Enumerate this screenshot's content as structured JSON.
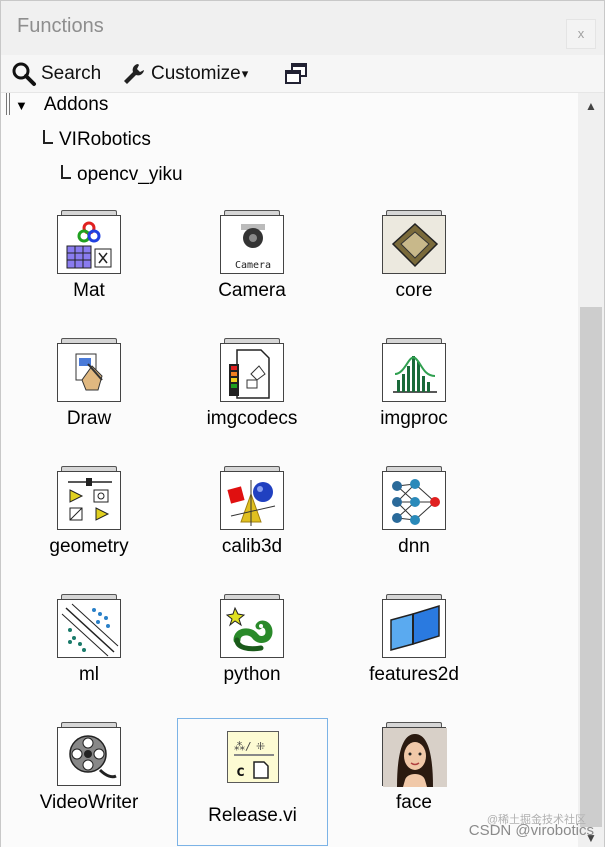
{
  "window": {
    "title": "Functions",
    "close_label": "x"
  },
  "toolbar": {
    "search_label": "Search",
    "customize_label": "Customize",
    "customize_caret": "▾"
  },
  "tree": {
    "expand_glyph": "▼",
    "addons": "Addons",
    "virobotics": "VIRobotics",
    "opencv": "opencv_yiku"
  },
  "items": [
    {
      "label": "Mat",
      "icon": "mat-icon"
    },
    {
      "label": "Camera",
      "icon": "camera-icon",
      "icon_text": "Camera"
    },
    {
      "label": "core",
      "icon": "chip-icon"
    },
    {
      "label": "Draw",
      "icon": "draw-icon"
    },
    {
      "label": "imgcodecs",
      "icon": "image-file-icon"
    },
    {
      "label": "imgproc",
      "icon": "histogram-icon"
    },
    {
      "label": "geometry",
      "icon": "geometry-icon"
    },
    {
      "label": "calib3d",
      "icon": "3d-shapes-icon"
    },
    {
      "label": "dnn",
      "icon": "neural-net-icon"
    },
    {
      "label": "ml",
      "icon": "scatter-icon"
    },
    {
      "label": "python",
      "icon": "python-icon"
    },
    {
      "label": "features2d",
      "icon": "plane-icon"
    },
    {
      "label": "VideoWriter",
      "icon": "film-reel-icon"
    },
    {
      "label": "Release.vi",
      "icon": "release-vi-icon",
      "selected": true
    },
    {
      "label": "face",
      "icon": "face-photo-icon"
    }
  ],
  "watermark": {
    "line1": "@稀土掘金技术社区",
    "line2": "CSDN @virobotics"
  },
  "colors": {
    "selection_border": "#7cb3e6",
    "panel_bg": "#fbfbfb",
    "toolbar_bg": "#f6f6f6"
  }
}
